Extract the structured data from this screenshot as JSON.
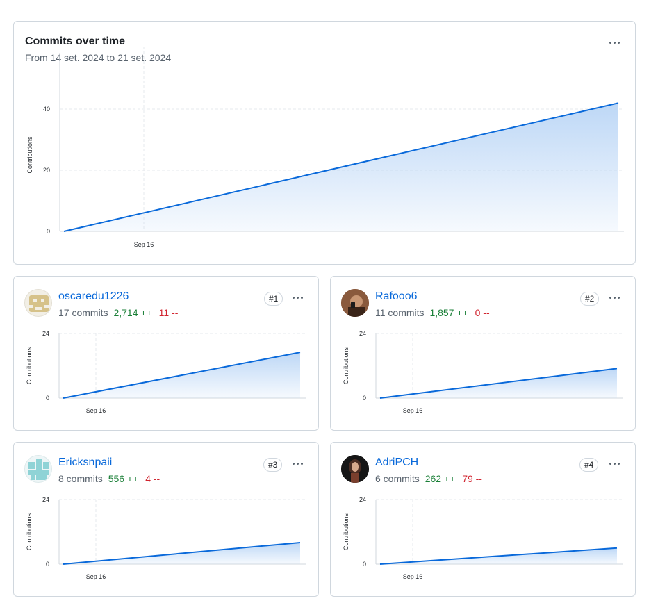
{
  "main_chart": {
    "title": "Commits over time",
    "subtitle": "From 14 set. 2024 to 21 set. 2024",
    "menu_icon": "kebab-horizontal-icon"
  },
  "contributors": [
    {
      "username": "oscaredu1226",
      "commits": "17 commits",
      "additions": "2,714 ++",
      "deletions": "11 --",
      "rank": "#1",
      "avatar_icon": "identicon-avatar"
    },
    {
      "username": "Rafooo6",
      "commits": "11 commits",
      "additions": "1,857 ++",
      "deletions": "0 --",
      "rank": "#2",
      "avatar_icon": "photo-avatar"
    },
    {
      "username": "Ericksnpaii",
      "commits": "8 commits",
      "additions": "556 ++",
      "deletions": "4 --",
      "rank": "#3",
      "avatar_icon": "identicon-avatar"
    },
    {
      "username": "AdriPCH",
      "commits": "6 commits",
      "additions": "262 ++",
      "deletions": "79 --",
      "rank": "#4",
      "avatar_icon": "photo-avatar"
    }
  ],
  "chart_data": [
    {
      "type": "area",
      "ylabel": "Contributions",
      "xticks": [
        "Sep 16"
      ],
      "yticks": [
        0,
        20,
        40
      ],
      "ylim": [
        0,
        50
      ],
      "x": [
        "2024-09-14",
        "2024-09-21"
      ],
      "y": [
        0,
        42
      ],
      "grid": true
    },
    {
      "type": "area",
      "ylabel": "Contributions",
      "xticks": [
        "Sep 16"
      ],
      "yticks": [
        0,
        24
      ],
      "ylim": [
        0,
        24
      ],
      "x": [
        "2024-09-14",
        "2024-09-21"
      ],
      "y": [
        0,
        17
      ],
      "grid": true
    },
    {
      "type": "area",
      "ylabel": "Contributions",
      "xticks": [
        "Sep 16"
      ],
      "yticks": [
        0,
        24
      ],
      "ylim": [
        0,
        24
      ],
      "x": [
        "2024-09-14",
        "2024-09-21"
      ],
      "y": [
        0,
        11
      ],
      "grid": true
    },
    {
      "type": "area",
      "ylabel": "Contributions",
      "xticks": [
        "Sep 16"
      ],
      "yticks": [
        0,
        24
      ],
      "ylim": [
        0,
        24
      ],
      "x": [
        "2024-09-14",
        "2024-09-21"
      ],
      "y": [
        0,
        8
      ],
      "grid": true
    },
    {
      "type": "area",
      "ylabel": "Contributions",
      "xticks": [
        "Sep 16"
      ],
      "yticks": [
        0,
        24
      ],
      "ylim": [
        0,
        24
      ],
      "x": [
        "2024-09-14",
        "2024-09-21"
      ],
      "y": [
        0,
        6
      ],
      "grid": true
    }
  ],
  "colors": {
    "line": "#0969da",
    "fill_top": "#b6d3f5",
    "link": "#0969da",
    "additions": "#1a7f37",
    "deletions": "#d1242f"
  }
}
